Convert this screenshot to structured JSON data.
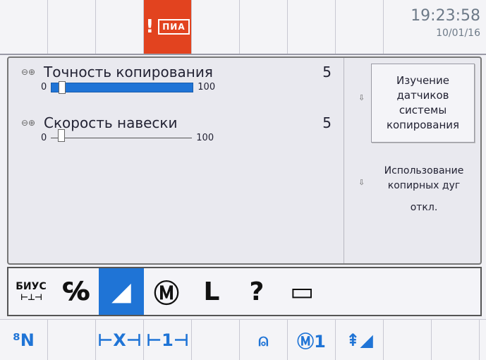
{
  "status": {
    "alert_icon": "warning-exclamation-icon",
    "alert_chip_text": "ПИА",
    "time": "19:23:58",
    "date": "10/01/16"
  },
  "params": [
    {
      "name": "Точность копирования",
      "value": "5",
      "min": "0",
      "max": "100",
      "position_percent": 5
    },
    {
      "name": "Скорость навески",
      "value": "5",
      "min": "0",
      "max": "100",
      "position_percent": 5
    }
  ],
  "side": {
    "study_button": "Изучение датчиков системы копирования",
    "arcs_label": "Использование копирных дуг",
    "arcs_state": "откл."
  },
  "modes": [
    {
      "icon": "biuc-balance-icon",
      "label": "БИУС",
      "symbol": "⊢⊥⊣"
    },
    {
      "icon": "tractor-settings-icon",
      "symbol": "℅"
    },
    {
      "icon": "hitch-slope-icon",
      "symbol": "◢"
    },
    {
      "icon": "m-arc-icon",
      "symbol": "Ⓜ"
    },
    {
      "icon": "l-angle-icon",
      "symbol": "L"
    },
    {
      "icon": "help-pages-icon",
      "symbol": "?"
    },
    {
      "icon": "display-screen-icon",
      "symbol": "▭"
    }
  ],
  "softkeys": [
    "⁸N",
    "",
    "⊢X⊣",
    "⊢1⊣",
    "",
    "⍝",
    "Ⓜ1",
    "⇞◢",
    "",
    ""
  ],
  "colors": {
    "accent": "#1f74d6",
    "alert": "#e2431f"
  }
}
